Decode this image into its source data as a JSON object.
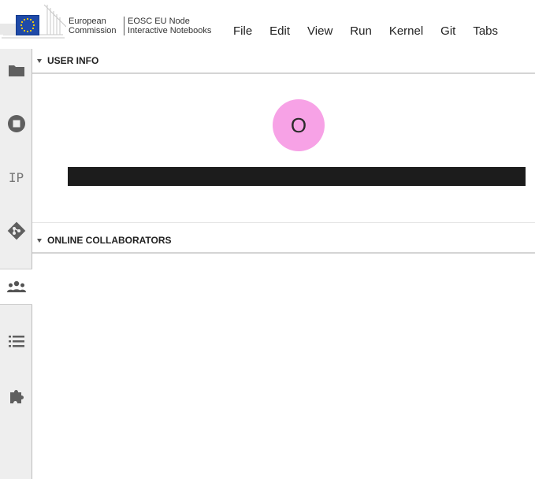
{
  "branding": {
    "org_line1": "European",
    "org_line2": "Commission",
    "node_line1": "EOSC EU Node",
    "node_line2": "Interactive Notebooks",
    "flag_color": "#1f4aa8"
  },
  "menu": [
    {
      "label": "File"
    },
    {
      "label": "Edit"
    },
    {
      "label": "View"
    },
    {
      "label": "Run"
    },
    {
      "label": "Kernel"
    },
    {
      "label": "Git"
    },
    {
      "label": "Tabs"
    }
  ],
  "sidebar": {
    "items": [
      {
        "icon": "folder-icon"
      },
      {
        "icon": "stop-circle-icon"
      },
      {
        "icon": "ip-icon",
        "text": "IP"
      },
      {
        "icon": "git-icon"
      },
      {
        "icon": "collaborators-icon",
        "active": true
      },
      {
        "icon": "list-icon"
      },
      {
        "icon": "extension-puzzle-icon"
      }
    ]
  },
  "user_info": {
    "header": "USER INFO",
    "avatar_initial": "O",
    "avatar_color": "#f7a2e6"
  },
  "online_collaborators": {
    "header": "ONLINE COLLABORATORS"
  }
}
